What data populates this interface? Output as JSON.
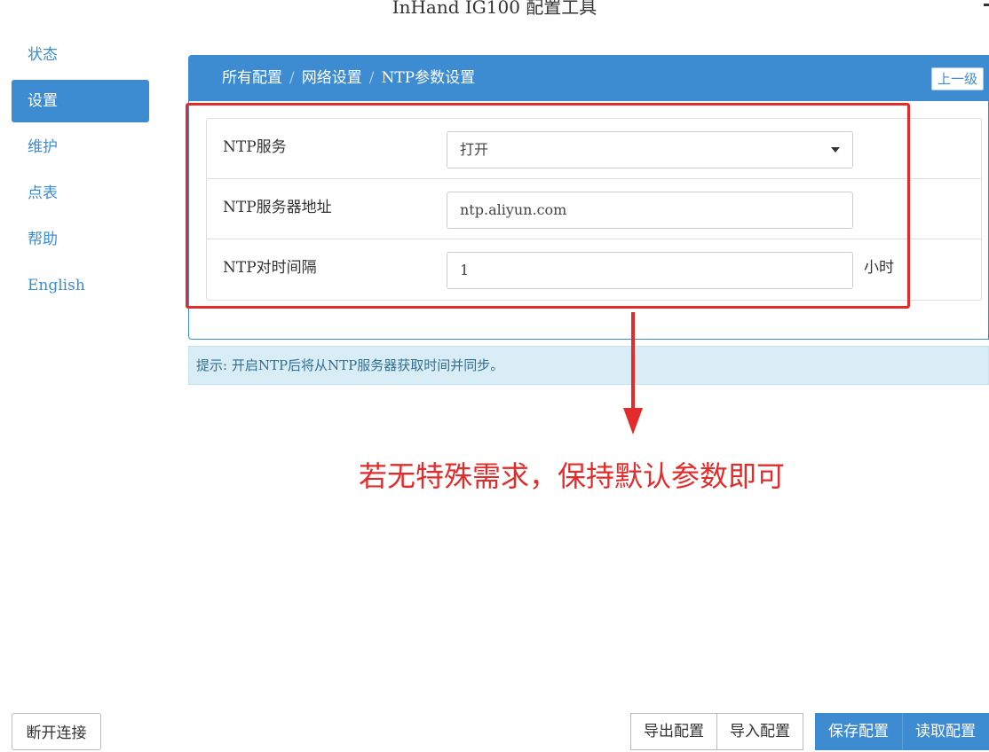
{
  "window": {
    "title": "InHand IG100 配置工具"
  },
  "sidebar": {
    "items": [
      {
        "label": "状态"
      },
      {
        "label": "设置"
      },
      {
        "label": "维护"
      },
      {
        "label": "点表"
      },
      {
        "label": "帮助"
      },
      {
        "label": "English"
      }
    ],
    "disconnect_label": "断开连接"
  },
  "breadcrumb": {
    "items": [
      "所有配置",
      "网络设置",
      "NTP参数设置"
    ],
    "separator": "/"
  },
  "back_button": "上一级",
  "form": {
    "ntp_service": {
      "label": "NTP服务",
      "value": "打开"
    },
    "ntp_server": {
      "label": "NTP服务器地址",
      "value": "ntp.aliyun.com"
    },
    "ntp_interval": {
      "label": "NTP对时间隔",
      "value": "1",
      "unit": "小时"
    }
  },
  "hint": "提示: 开启NTP后将从NTP服务器获取时间并同步。",
  "annotation": {
    "text": "若无特殊需求，保持默认参数即可",
    "color": "#e42b2b"
  },
  "footer_buttons": {
    "export": "导出配置",
    "import": "导入配置",
    "save": "保存配置",
    "read": "读取配置"
  },
  "colors": {
    "accent": "#3d8bd0",
    "hint_bg": "#d9edf7",
    "annotation_red": "#e42b2b"
  }
}
